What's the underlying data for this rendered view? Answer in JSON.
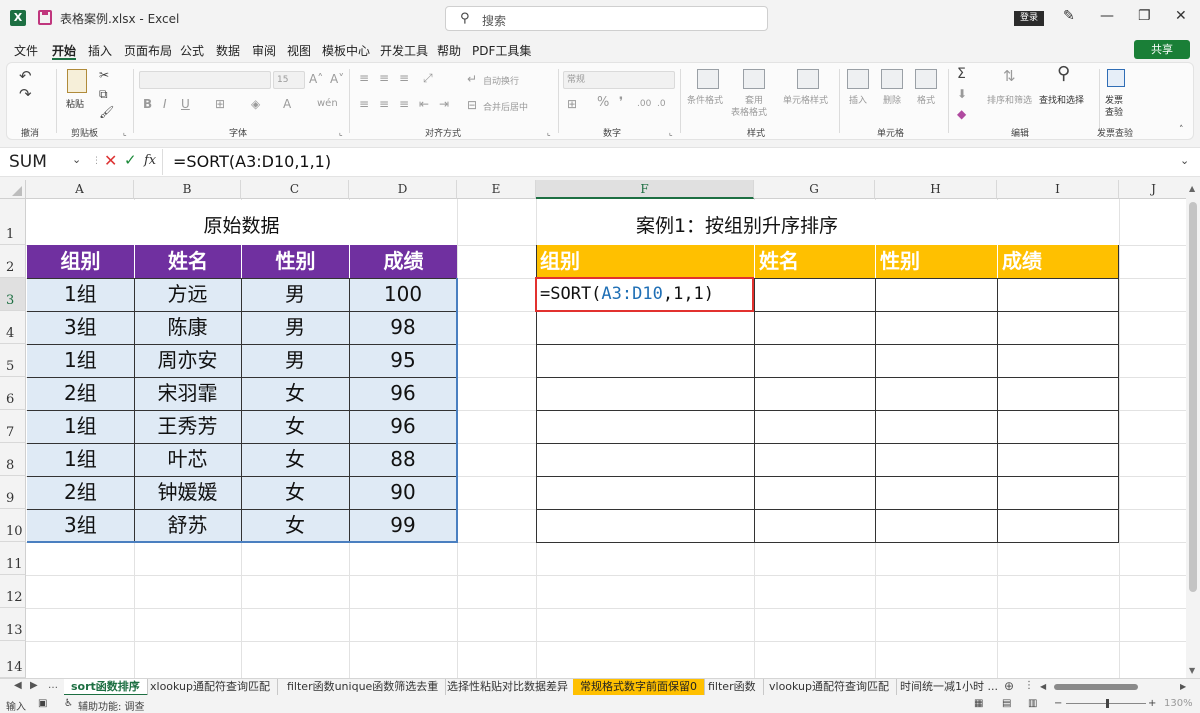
{
  "titlebar": {
    "filename": "表格案例.xlsx  -  Excel",
    "search_placeholder": "搜索",
    "login": "登录"
  },
  "menu": {
    "tabs": [
      "文件",
      "开始",
      "插入",
      "页面布局",
      "公式",
      "数据",
      "审阅",
      "视图",
      "模板中心",
      "开发工具",
      "帮助",
      "PDF工具集"
    ],
    "active": "开始",
    "share": "共享"
  },
  "ribbon": {
    "groups": {
      "undo": "撤消",
      "clipboard": "剪贴板",
      "font": "字体",
      "alignment": "对齐方式",
      "number": "数字",
      "styles": "样式",
      "cells": "单元格",
      "editing": "编辑",
      "invoice": "发票查验"
    },
    "paste": "粘贴",
    "font_size": "15",
    "wrap_text": "自动换行",
    "merge_center": "合并后居中",
    "number_format": "常规",
    "conditional_format": "条件格式",
    "table_format_1": "套用",
    "table_format_2": "表格格式",
    "cell_styles": "单元格样式",
    "insert": "插入",
    "delete": "删除",
    "format": "格式",
    "sort_filter": "排序和筛选",
    "find_select": "查找和选择",
    "invoice_1": "发票",
    "invoice_2": "查验"
  },
  "formula_bar": {
    "name_box": "SUM",
    "formula": "=SORT(A3:D10,1,1)"
  },
  "grid": {
    "columns": [
      "A",
      "B",
      "C",
      "D",
      "E",
      "F",
      "G",
      "H",
      "I",
      "J"
    ],
    "rows": [
      "1",
      "2",
      "3",
      "4",
      "5",
      "6",
      "7",
      "8",
      "9",
      "10",
      "11",
      "12",
      "13",
      "14"
    ],
    "left_title": "原始数据",
    "left_headers": [
      "组别",
      "姓名",
      "性别",
      "成绩"
    ],
    "left_rows": [
      [
        "1组",
        "方远",
        "男",
        "100"
      ],
      [
        "3组",
        "陈康",
        "男",
        "98"
      ],
      [
        "1组",
        "周亦安",
        "男",
        "95"
      ],
      [
        "2组",
        "宋羽霏",
        "女",
        "96"
      ],
      [
        "1组",
        "王秀芳",
        "女",
        "96"
      ],
      [
        "1组",
        "叶芯",
        "女",
        "88"
      ],
      [
        "2组",
        "钟媛媛",
        "女",
        "90"
      ],
      [
        "3组",
        "舒苏",
        "女",
        "99"
      ]
    ],
    "right_title": "案例1：按组别升序排序",
    "right_headers": [
      "组别",
      "姓名",
      "性别",
      "成绩"
    ],
    "editing_cell": {
      "prefix": "=SORT(",
      "ref": "A3:D10",
      "suffix": ",1,1)"
    }
  },
  "sheets": {
    "tabs": [
      "sort函数排序",
      "xlookup通配符查询匹配",
      "filter函数unique函数筛选去重",
      "选择性粘贴对比数据差异",
      "常规格式数字前面保留0",
      "filter函数",
      "vlookup通配符查询匹配",
      "时间统一减1小时 ..."
    ],
    "active_index": 0,
    "highlight_index": 4
  },
  "status": {
    "mode": "输入",
    "accessibility": "辅助功能: 调查",
    "zoom": "130%"
  }
}
